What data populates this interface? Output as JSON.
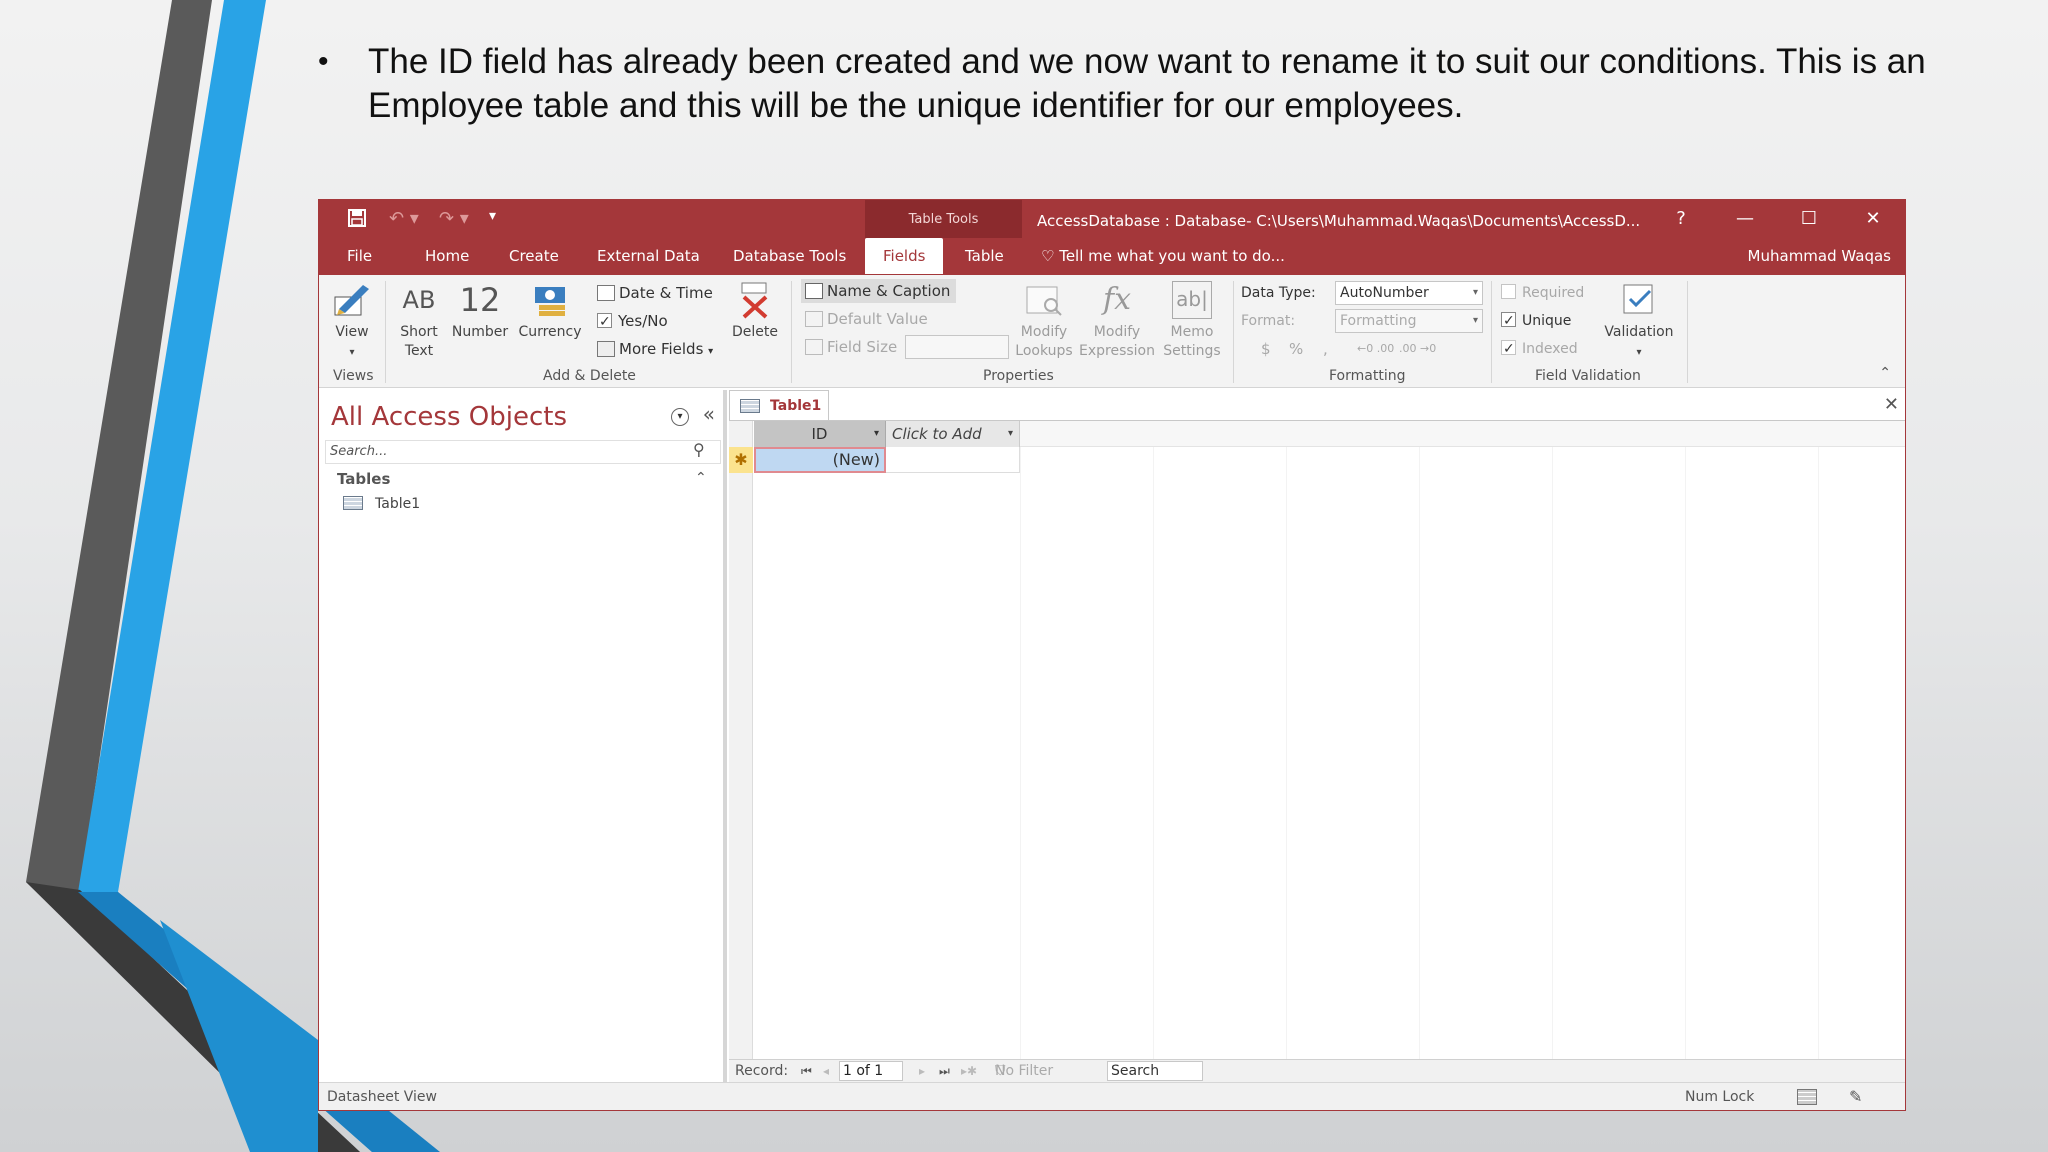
{
  "slide": {
    "bullet_marker": "•",
    "bullet_text": "The ID field has already been created and we now want to rename it to suit our conditions. This is an Employee table and this will be the unique identifier for our employees.",
    "colors": {
      "accent_blue": "#1e9be0",
      "dark_gray": "#3a3a3a"
    }
  },
  "window": {
    "context_group": "Table Tools",
    "title": "AccessDatabase : Database- C:\\Users\\Muhammad.Waqas\\Documents\\AccessD...",
    "help": "?",
    "minimize": "—",
    "maximize": "☐",
    "close": "✕",
    "accent_color": "#a4373a"
  },
  "tabs": [
    {
      "label": "File"
    },
    {
      "label": "Home"
    },
    {
      "label": "Create"
    },
    {
      "label": "External Data"
    },
    {
      "label": "Database Tools"
    },
    {
      "label": "Fields",
      "active": true
    },
    {
      "label": "Table"
    }
  ],
  "tell_me": "Tell me what you want to do...",
  "user_name": "Muhammad Waqas",
  "ribbon": {
    "views": {
      "label": "Views",
      "view_btn": "View"
    },
    "add_delete": {
      "label": "Add & Delete",
      "short_text_icon": "AB",
      "short_text": "Short Text",
      "number_icon": "12",
      "number": "Number",
      "currency": "Currency",
      "date_time": "Date & Time",
      "yes_no": "Yes/No",
      "more_fields": "More Fields",
      "delete": "Delete"
    },
    "properties": {
      "label": "Properties",
      "name_caption": "Name & Caption",
      "default_value": "Default Value",
      "field_size": "Field Size",
      "modify_lookups": "Modify Lookups",
      "modify_expression": "Modify Expression",
      "memo_settings": "Memo Settings"
    },
    "formatting": {
      "label": "Formatting",
      "data_type_label": "Data Type:",
      "data_type_value": "AutoNumber",
      "format_label": "Format:",
      "format_value": "Formatting",
      "currency_sym": "$",
      "percent_sym": "%",
      "comma_sym": ",",
      "inc_dec": "←0 .00",
      "dec_dec": ".00 →0"
    },
    "field_validation": {
      "label": "Field Validation",
      "required": "Required",
      "unique": "Unique",
      "indexed": "Indexed",
      "validation": "Validation"
    }
  },
  "nav_pane": {
    "title": "All Access Objects",
    "search_placeholder": "Search...",
    "group": "Tables",
    "items": [
      {
        "label": "Table1"
      }
    ]
  },
  "document": {
    "tab_label": "Table1",
    "columns": [
      {
        "label": "ID"
      },
      {
        "label": "Click to Add"
      }
    ],
    "new_row_value": "(New)",
    "record_nav": {
      "label": "Record:",
      "current": "1 of 1",
      "no_filter": "No Filter",
      "search": "Search"
    }
  },
  "status": {
    "left": "Datasheet View",
    "num_lock": "Num Lock"
  }
}
